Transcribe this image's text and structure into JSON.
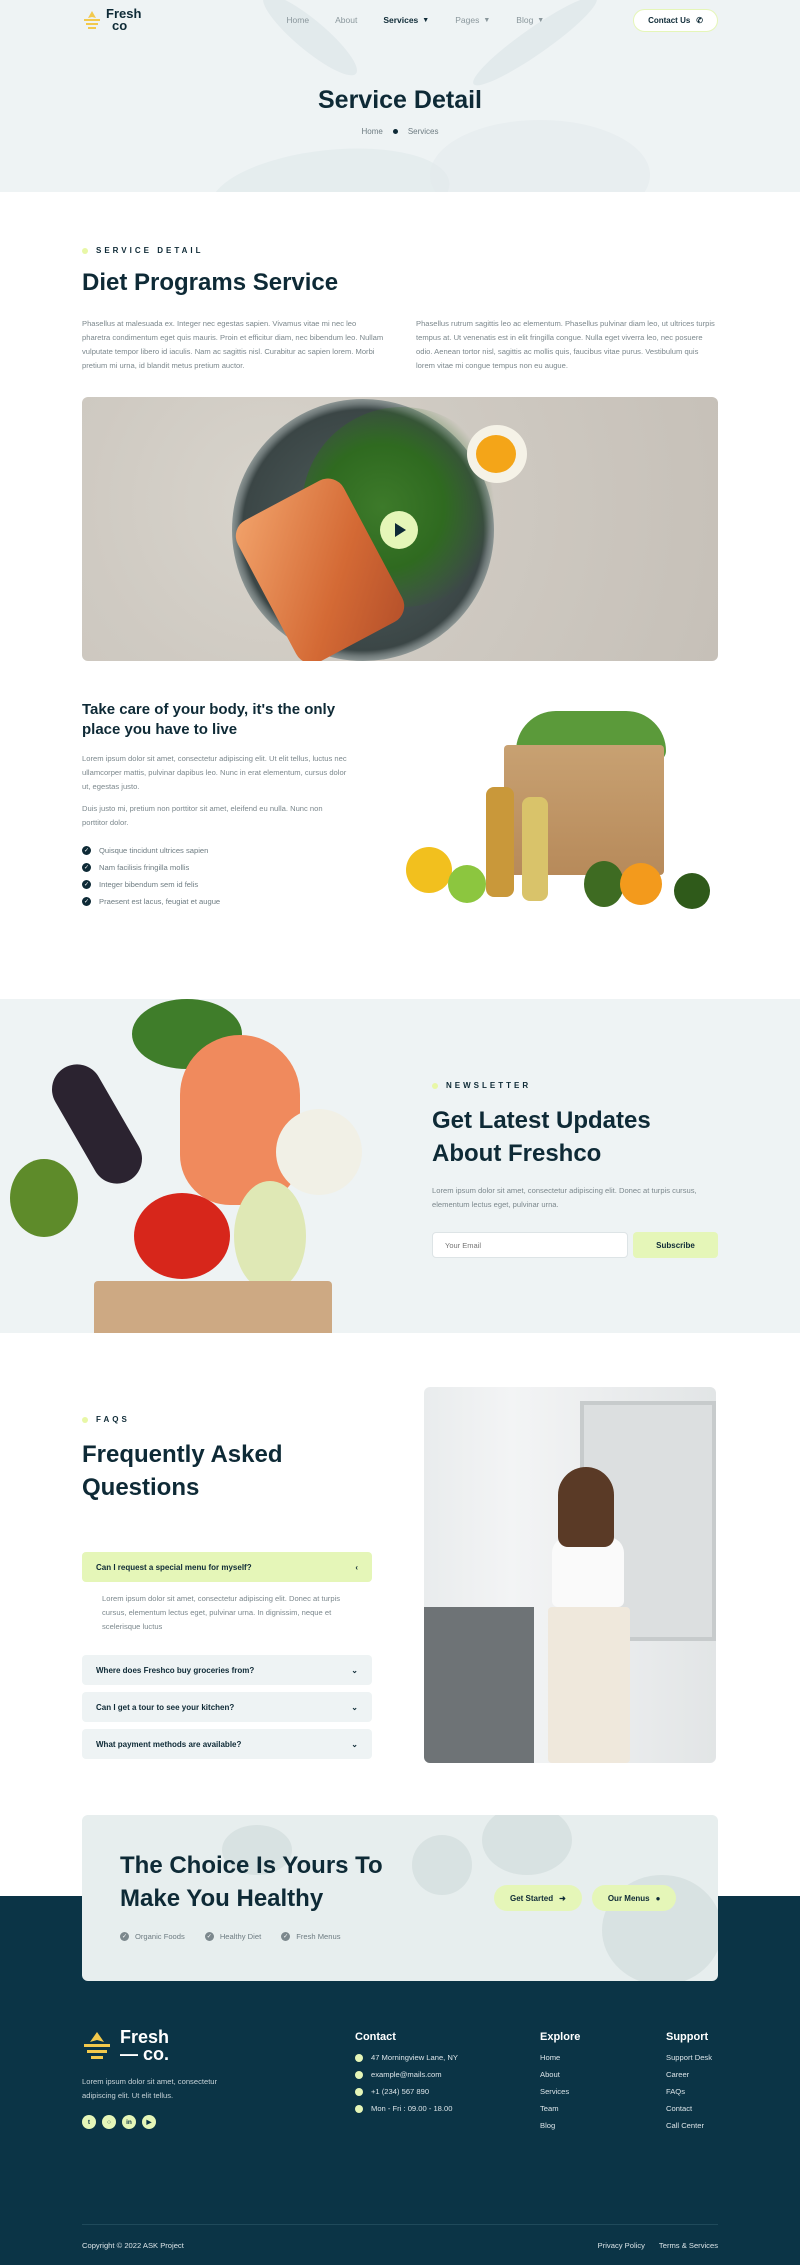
{
  "brand": {
    "name_line1": "Fresh",
    "name_line2": "co"
  },
  "nav": {
    "items": [
      {
        "label": "Home"
      },
      {
        "label": "About"
      },
      {
        "label": "Services"
      },
      {
        "label": "Pages"
      },
      {
        "label": "Blog"
      }
    ],
    "contact_label": "Contact Us"
  },
  "hero": {
    "title": "Service Detail",
    "breadcrumb": [
      "Home",
      "Services"
    ]
  },
  "service": {
    "eyebrow": "SERVICE DETAIL",
    "title": "Diet Programs Service",
    "paragraph_left": "Phasellus at malesuada ex. Integer nec egestas sapien. Vivamus vitae mi nec leo pharetra condimentum eget quis mauris. Proin et efficitur diam, nec bibendum leo. Nullam vulputate tempor libero id iaculis. Nam ac sagittis nisl. Curabitur ac sapien lorem. Morbi pretium mi urna, id blandit metus pretium auctor.",
    "paragraph_right": "Phasellus rutrum sagittis leo ac elementum. Phasellus pulvinar diam leo, ut ultrices turpis tempus at. Ut venenatis est in elit fringilla congue. Nulla eget viverra leo, nec posuere odio. Aenean tortor nisl, sagittis ac mollis quis, faucibus vitae purus. Vestibulum quis lorem vitae mi congue tempus non eu augue."
  },
  "care": {
    "title": "Take care of your body, it's the only place you have to live",
    "paragraph_1": "Lorem ipsum dolor sit amet, consectetur adipiscing elit. Ut elit tellus, luctus nec ullamcorper mattis, pulvinar dapibus leo. Nunc in erat elementum, cursus dolor ut, egestas justo.",
    "paragraph_2": "Duis justo mi, pretium non porttitor sit amet, eleifend eu nulla. Nunc non porttitor dolor.",
    "checklist": [
      "Quisque tincidunt ultrices sapien",
      "Nam facilisis fringilla mollis",
      "Integer bibendum sem id felis",
      "Praesent est lacus, feugiat et augue"
    ]
  },
  "newsletter": {
    "eyebrow": "NEWSLETTER",
    "title": "Get Latest Updates About Freshco",
    "text": "Lorem ipsum dolor sit amet, consectetur adipiscing elit. Donec at turpis cursus, elementum lectus eget, pulvinar urna.",
    "email_placeholder": "Your Email",
    "button_label": "Subscribe"
  },
  "faq": {
    "eyebrow": "FAQS",
    "title": "Frequently Asked Questions",
    "items": [
      {
        "question": "Can I request a special menu for myself?",
        "answer": "Lorem ipsum dolor sit amet, consectetur adipiscing elit. Donec at turpis cursus, elementum lectus eget, pulvinar urna. In dignissim, neque et scelerisque luctus"
      },
      {
        "question": "Where does Freshco buy groceries from?"
      },
      {
        "question": "Can I get a tour to see your kitchen?"
      },
      {
        "question": "What payment methods are available?"
      }
    ]
  },
  "cta": {
    "title": "The Choice Is Yours To Make You Healthy",
    "tags": [
      "Organic Foods",
      "Healthy Diet",
      "Fresh Menus"
    ],
    "primary_label": "Get Started",
    "secondary_label": "Our Menus"
  },
  "footer": {
    "brand_line1": "Fresh",
    "brand_line2": "— co.",
    "about": "Lorem ipsum dolor sit amet, consectetur adipiscing elit. Ut elit tellus.",
    "contact_title": "Contact",
    "contact": [
      "47 Morningview Lane, NY",
      "example@mails.com",
      "+1 (234) 567 890",
      "Mon - Fri : 09.00 - 18.00"
    ],
    "explore_title": "Explore",
    "explore": [
      "Home",
      "About",
      "Services",
      "Team",
      "Blog"
    ],
    "support_title": "Support",
    "support": [
      "Support Desk",
      "Career",
      "FAQs",
      "Contact",
      "Call Center"
    ],
    "copyright": "Copyright © 2022 ASK Project",
    "legal": [
      "Privacy Policy",
      "Terms & Services"
    ]
  },
  "colors": {
    "accent": "#e5f6b8",
    "dark": "#0e2a36",
    "footer_bg": "#0b3446",
    "light_bg": "#eef3f4"
  }
}
